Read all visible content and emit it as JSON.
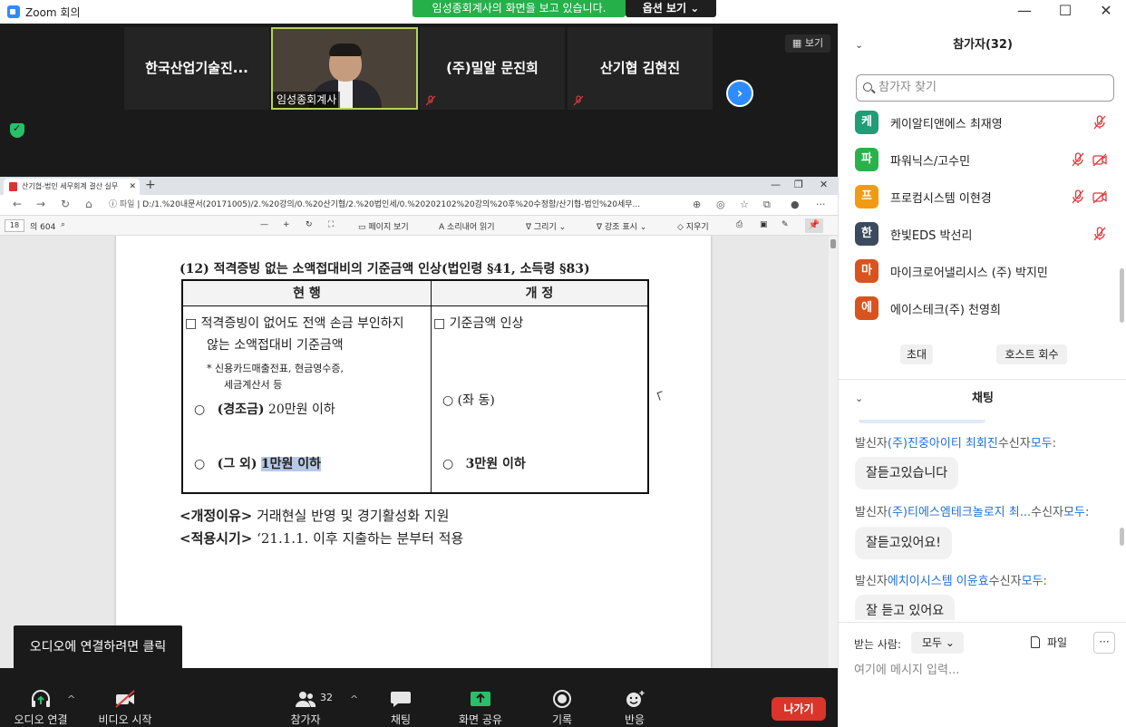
{
  "window": {
    "title": "Zoom 회의",
    "share_banner": "임성종회계사의 화면을 보고 있습니다.",
    "options_label": "옵션 보기"
  },
  "thumbnails": {
    "t1": "한국산업기술진...",
    "t2": "임성종회계사",
    "t3": "(주)밀알 문진희",
    "t4": "산기협 김현진",
    "view_label": "보기"
  },
  "browser": {
    "tab_title": "산기협-법인 세무회계 결산 실무",
    "url_proto": "파일",
    "url": "D:/1.%20내문서(20171005)/2.%20강의/0.%20산기협/2.%20법인세/0.%20202102%20강의%20후%20수정함/산기협-법인%20세무...",
    "page_num": "18",
    "page_total": "의 604",
    "toolbar": {
      "page_view": "페이지 보기",
      "read_aloud": "소리내어 읽기",
      "draw": "그리기",
      "highlight": "강조 표시",
      "erase": "지우기"
    }
  },
  "document": {
    "section_title": "(12) 적격증빙 없는 소액접대비의 기준금액 인상(법인령 §41, 소득령 §83)",
    "col_current": "현      행",
    "col_revised": "개      정",
    "current_line1": "□ 적격증빙이 없어도 전액 손금 부인하지",
    "current_line2": "않는 소액접대비 기준금액",
    "current_note1": "* 신용카드매출전표, 현금영수증,",
    "current_note2": "세금계산서 등",
    "current_item1_label": "(경조금)",
    "current_item1_value": "20만원 이하",
    "current_item2_label": "(그 외)",
    "current_item2_value": "1만원 이하",
    "revised_line1": "□ 기준금액 인상",
    "revised_item1": "○  (좌 동)",
    "revised_item2": "3만원 이하",
    "bullet": "○",
    "reason_label": "<개정이유>",
    "reason_text": "거래현실 반영 및 경기활성화 지원",
    "apply_label": "<적용시기>",
    "apply_text": "‘21.1.1. 이후 지출하는 분부터 적용"
  },
  "tooltip": "오디오에 연결하려면 클릭",
  "bottombar": {
    "audio": "오디오 연결",
    "video": "비디오 시작",
    "participants": "참가자",
    "participants_count": "32",
    "chat": "채팅",
    "share": "화면 공유",
    "record": "기록",
    "reactions": "반응",
    "leave": "나가기"
  },
  "participants_panel": {
    "title": "참가자(32)",
    "search_placeholder": "참가자 찾기",
    "list": [
      {
        "initial": "케",
        "name": "케이알티앤에스 최재영",
        "color": "#1f9d76"
      },
      {
        "initial": "파",
        "name": "파워닉스/고수민",
        "color": "#2ab24a"
      },
      {
        "initial": "프",
        "name": "프로컴시스템 이현경",
        "color": "#f29a12"
      },
      {
        "initial": "한",
        "name": "한빛EDS 박선리",
        "color": "#3b4a5e"
      },
      {
        "initial": "마",
        "name": "마이크로어낼리시스 (주) 박지민",
        "color": "#d9531e"
      },
      {
        "initial": "에",
        "name": "에이스테크(주) 천영희",
        "color": "#d9531e"
      }
    ],
    "invite": "초대",
    "reclaim_host": "호스트 회수"
  },
  "chat_panel": {
    "title": "채팅",
    "sender_prefix": "발신자",
    "receiver_prefix": "수신자",
    "everyone": "모두",
    "messages": [
      {
        "from": "(주)진중아이티 최회진",
        "text": "잘듣고있습니다"
      },
      {
        "from": "(주)티에스엠테크놀로지 최...",
        "text": "잘듣고있어요!"
      },
      {
        "from": "에치이시스템 이윤효",
        "text": "잘 듣고 있어요"
      }
    ],
    "to_label": "받는 사람:",
    "to_value": "모두",
    "file": "파일",
    "more": "···",
    "input_placeholder": "여기에 메시지 입력..."
  }
}
